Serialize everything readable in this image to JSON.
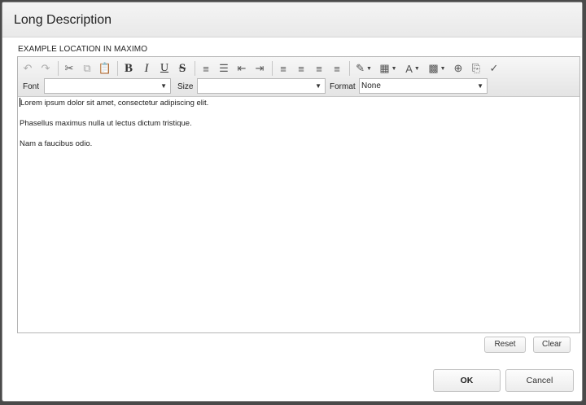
{
  "dialog": {
    "title": "Long Description",
    "location_label": "EXAMPLE LOCATION IN MAXIMO"
  },
  "toolbar": {
    "row1": [
      {
        "name": "undo-icon",
        "glyph": "↶",
        "disabled": true
      },
      {
        "name": "redo-icon",
        "glyph": "↷",
        "disabled": true
      },
      {
        "sep": true
      },
      {
        "name": "cut-icon",
        "glyph": "✂",
        "disabled": false
      },
      {
        "name": "copy-icon",
        "glyph": "⧉",
        "disabled": true
      },
      {
        "name": "paste-icon",
        "glyph": "📋",
        "disabled": false
      },
      {
        "sep": true
      },
      {
        "name": "bold-icon",
        "glyph": "B",
        "cls": "b"
      },
      {
        "name": "italic-icon",
        "glyph": "I",
        "cls": "i"
      },
      {
        "name": "underline-icon",
        "glyph": "U",
        "cls": "u"
      },
      {
        "name": "strikethrough-icon",
        "glyph": "S",
        "cls": "s"
      },
      {
        "sep": true
      },
      {
        "name": "ordered-list-icon",
        "glyph": "≡"
      },
      {
        "name": "unordered-list-icon",
        "glyph": "☰"
      },
      {
        "name": "outdent-icon",
        "glyph": "⇤"
      },
      {
        "name": "indent-icon",
        "glyph": "⇥"
      },
      {
        "sep": true
      },
      {
        "name": "align-left-icon",
        "glyph": "≡"
      },
      {
        "name": "align-right-icon",
        "glyph": "≡"
      },
      {
        "name": "align-center-icon",
        "glyph": "≡"
      },
      {
        "name": "align-justify-icon",
        "glyph": "≡"
      },
      {
        "sep": true
      },
      {
        "name": "highlight-icon",
        "glyph": "✎",
        "dropdown": true
      },
      {
        "name": "table-icon",
        "glyph": "▦",
        "dropdown": true
      },
      {
        "name": "font-color-icon",
        "glyph": "A",
        "dropdown": true
      },
      {
        "name": "background-color-icon",
        "glyph": "▩",
        "dropdown": true
      },
      {
        "name": "insert-icon",
        "glyph": "⊕"
      },
      {
        "name": "paste-special-icon",
        "glyph": "⎘"
      },
      {
        "name": "spellcheck-icon",
        "glyph": "✓"
      }
    ],
    "font_label": "Font",
    "font_value": "",
    "size_label": "Size",
    "size_value": "",
    "format_label": "Format",
    "format_value": "None"
  },
  "content": {
    "paragraphs": [
      "Lorem ipsum dolor sit amet, consectetur adipiscing elit.",
      "Phasellus maximus nulla ut lectus dictum tristique.",
      "Nam a faucibus odio."
    ]
  },
  "actions": {
    "reset_label": "Reset",
    "clear_label": "Clear",
    "ok_label": "OK",
    "cancel_label": "Cancel"
  }
}
